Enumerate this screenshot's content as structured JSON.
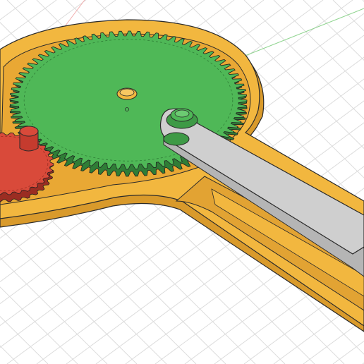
{
  "viewport": {
    "kind": "3d-cad-viewport",
    "background": "#ffffff",
    "grid_color": "#d9d9d9",
    "axis_green": "#6fcf6f",
    "axis_red": "#f0a0a0"
  },
  "model": {
    "base_plate": {
      "name": "base",
      "color": "#f2b73f",
      "edge": "#2a2a2a"
    },
    "large_gear": {
      "name": "large-gear",
      "color": "#4fb857"
    },
    "small_gear": {
      "name": "small-gear",
      "color": "#d94a3a"
    },
    "arm": {
      "name": "lever-arm",
      "color": "#c9c9c9"
    },
    "hub_pin": {
      "name": "center-pin",
      "color": "#f2b73f"
    },
    "arm_pin": {
      "name": "arm-pivot-pin",
      "color": "#4fb857"
    },
    "small_pin": {
      "name": "small-gear-pin",
      "color": "#d94a3a"
    }
  }
}
